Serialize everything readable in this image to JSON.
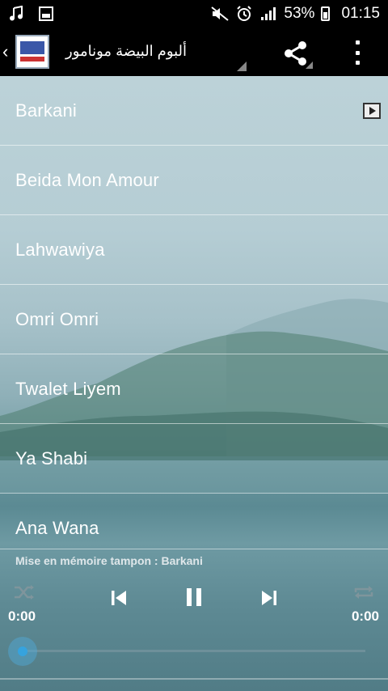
{
  "status_bar": {
    "battery_percent": "53%",
    "time": "01:15",
    "icons": [
      "music-note-icon",
      "image-icon",
      "mute-icon",
      "alarm-icon",
      "signal-icon",
      "battery-icon"
    ]
  },
  "app_bar": {
    "title": "ألبوم البيضة مونامور",
    "icons": [
      "back-chevron-icon",
      "app-logo",
      "share-icon",
      "overflow-menu-icon"
    ]
  },
  "songs": [
    {
      "title": "Barkani",
      "playing": true
    },
    {
      "title": "Beida Mon Amour"
    },
    {
      "title": "Lahwawiya"
    },
    {
      "title": "Omri Omri"
    },
    {
      "title": "Twalet Liyem"
    },
    {
      "title": "Ya Shabi"
    },
    {
      "title": "Ana Wana"
    }
  ],
  "player": {
    "buffer_text": "Mise en mémoire tampon : Barkani",
    "current_time": "0:00",
    "total_time": "0:00",
    "progress": 0,
    "controls": [
      "shuffle-icon",
      "previous-icon",
      "pause-icon",
      "next-icon",
      "repeat-icon"
    ],
    "accent_color": "#36a3de"
  }
}
